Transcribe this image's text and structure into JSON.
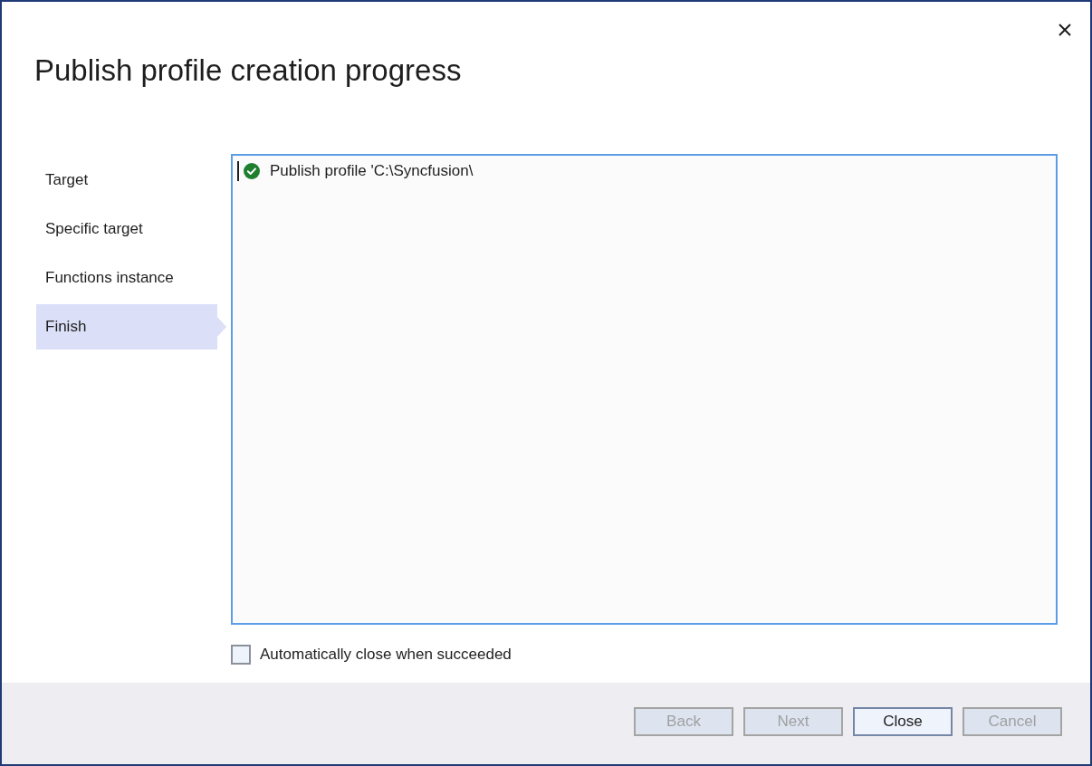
{
  "window": {
    "title": "Publish profile creation progress"
  },
  "steps": [
    {
      "label": "Target",
      "selected": false
    },
    {
      "label": "Specific target",
      "selected": false
    },
    {
      "label": "Functions instance",
      "selected": false
    },
    {
      "label": "Finish",
      "selected": true
    }
  ],
  "log": {
    "focused": true,
    "lines": [
      {
        "kind": "success",
        "text": "Publish profile 'C:\\Syncfusion\\"
      }
    ]
  },
  "auto_close": {
    "label": "Automatically close when succeeded",
    "checked": false
  },
  "buttons": [
    {
      "label": "Back",
      "disabled": true
    },
    {
      "label": "Next",
      "disabled": true
    },
    {
      "label": "Close",
      "disabled": false
    },
    {
      "label": "Cancel",
      "disabled": true
    }
  ]
}
